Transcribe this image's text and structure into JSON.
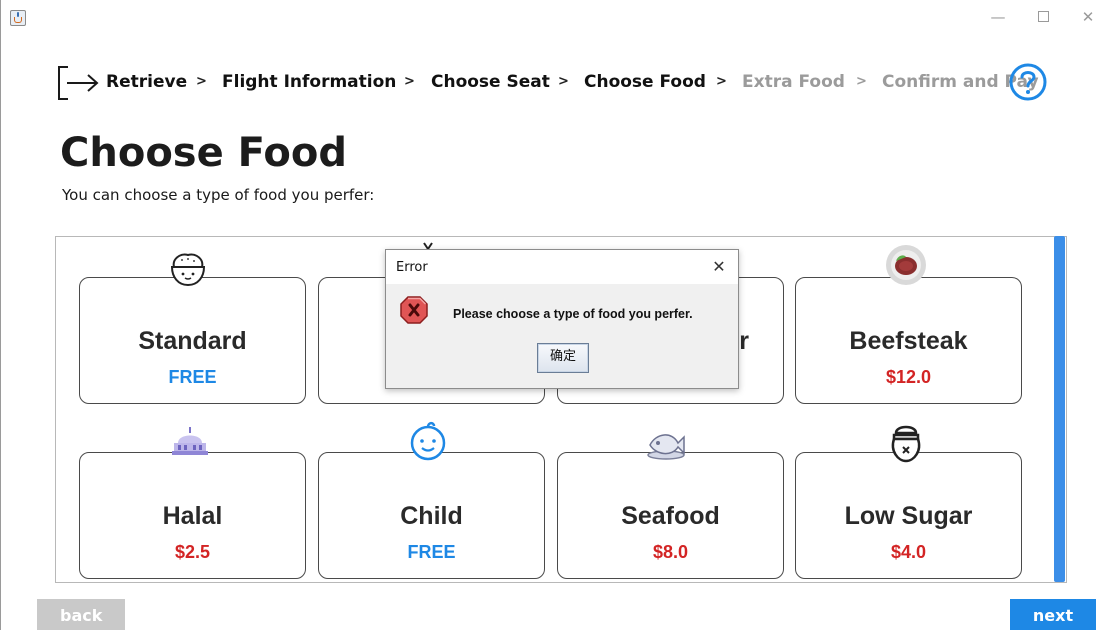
{
  "window": {
    "minimize_glyph": "—",
    "close_glyph": "✕"
  },
  "breadcrumb": {
    "steps": [
      {
        "label": "Retrieve",
        "state": "done"
      },
      {
        "label": "Flight Information",
        "state": "done"
      },
      {
        "label": "Choose Seat",
        "state": "done"
      },
      {
        "label": "Choose Food",
        "state": "done"
      },
      {
        "label": "Extra Food",
        "state": "pending"
      },
      {
        "label": "Confirm and Pay",
        "state": "pending"
      }
    ],
    "separator": ">",
    "icons": {
      "start": "exit-arrow-icon",
      "help": "help-question-icon"
    },
    "help_color": "#1e88e5"
  },
  "page": {
    "title": "Choose Food",
    "subtitle": "You can choose a type of food you perfer:"
  },
  "foods": [
    {
      "name": "Standard",
      "price": "FREE",
      "icon": "rice-bowl-icon",
      "free": true
    },
    {
      "name": "",
      "price": "",
      "icon": "vegetable-icon",
      "free": true
    },
    {
      "name": "r",
      "price": "",
      "icon": "",
      "free": true
    },
    {
      "name": "Beefsteak",
      "price": "$12.0",
      "icon": "steak-plate-icon",
      "free": false
    },
    {
      "name": "Halal",
      "price": "$2.5",
      "icon": "mosque-icon",
      "free": false
    },
    {
      "name": "Child",
      "price": "FREE",
      "icon": "baby-face-icon",
      "free": true
    },
    {
      "name": "Seafood",
      "price": "$8.0",
      "icon": "fish-plate-icon",
      "free": false
    },
    {
      "name": "Low Sugar",
      "price": "$4.0",
      "icon": "sugar-jar-icon",
      "free": false
    }
  ],
  "colors": {
    "accent": "#1e88e5",
    "price_paid": "#d32424",
    "back_button": "#c9c9c9",
    "error_icon": "#d93b3b"
  },
  "dialog": {
    "title": "Error",
    "close_glyph": "✕",
    "icon": "error-icon",
    "message": "Please choose a type of food you perfer.",
    "ok_label": "确定"
  },
  "buttons": {
    "back": "back",
    "next": "next"
  }
}
